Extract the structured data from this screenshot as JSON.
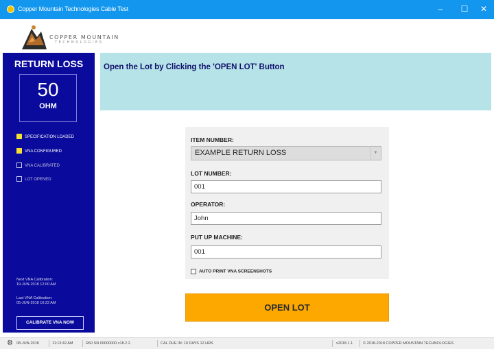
{
  "window": {
    "title": "Copper Mountain Technologies Cable Test",
    "minimize": "–",
    "maximize": "☐",
    "close": "✕"
  },
  "logo": {
    "text_line1": "COPPER MOUNTAIN",
    "text_line2": "TECHNOLOGIES"
  },
  "sidebar": {
    "title": "RETURN LOSS",
    "impedance_value": "50",
    "impedance_unit": "OHM",
    "status_items": [
      {
        "label": "SPECIFICATION LOADED",
        "checked": true
      },
      {
        "label": "VNA CONFIGURED",
        "checked": true
      },
      {
        "label": "VNA CALIBRATED",
        "checked": false
      },
      {
        "label": "LOT OPENED",
        "checked": false
      }
    ],
    "next_cal_label": "Next VNA Calibration:",
    "next_cal_value": "19-JUN-2018 12:00 AM",
    "last_cal_label": "Last VNA Calibration:",
    "last_cal_value": "05-JUN-2018 10:22 AM",
    "calibrate_button": "CALIBRATE VNA NOW"
  },
  "banner": {
    "message": "Open the Lot by Clicking the 'OPEN LOT' Button"
  },
  "form": {
    "item_number_label": "ITEM NUMBER:",
    "item_number_value": "EXAMPLE RETURN LOSS",
    "lot_number_label": "LOT NUMBER:",
    "lot_number_value": "001",
    "operator_label": "OPERATOR:",
    "operator_value": "John",
    "put_up_machine_label": "PUT UP MACHINE:",
    "put_up_machine_value": "001",
    "auto_print_label": "AUTO PRINT VNA SCREENSHOTS",
    "auto_print_checked": false
  },
  "open_lot_button": "OPEN LOT",
  "statusbar": {
    "date": "08-JUN-2018",
    "time": "11:13:42 AM",
    "instrument": "R60  SN 00000000  v18.2.2",
    "cal_due": "CAL DUE IN: 10 DAYS 12 HRS",
    "version": "v2018.1.1",
    "copyright": "© 2018-2018 COPPER MOUNTAIN TECHNOLOGIES"
  },
  "colors": {
    "titlebar": "#1296ee",
    "sidebar": "#0a0a9c",
    "banner": "#b6e3e8",
    "open_lot": "#fca800",
    "status_checked": "#f5e032"
  }
}
